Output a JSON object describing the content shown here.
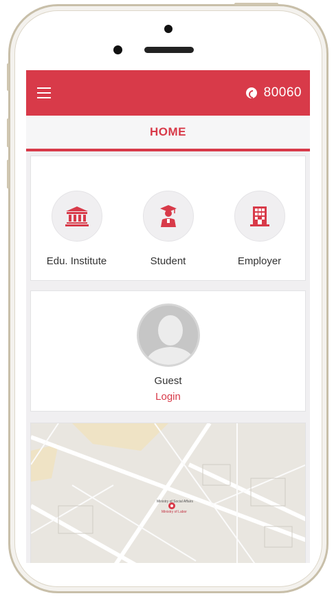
{
  "appbar": {
    "menu_icon": "hamburger-menu-icon",
    "phone_icon": "phone-icon",
    "phone_number": "80060",
    "background": "#d83a49"
  },
  "titlebar": {
    "title": "HOME"
  },
  "categories": [
    {
      "label": "Edu. Institute",
      "icon": "institute-building-icon"
    },
    {
      "label": "Student",
      "icon": "graduate-student-icon"
    },
    {
      "label": "Employer",
      "icon": "office-building-icon"
    }
  ],
  "user": {
    "name": "Guest",
    "login_label": "Login",
    "avatar": "default-avatar-icon"
  },
  "map": {
    "labels": {
      "ministry_of_labor": "Ministry of Labor",
      "ministry_social": "Ministry of Social Affairs"
    }
  },
  "colors": {
    "accent": "#d83a49",
    "screen_bg": "#f0eff1"
  }
}
